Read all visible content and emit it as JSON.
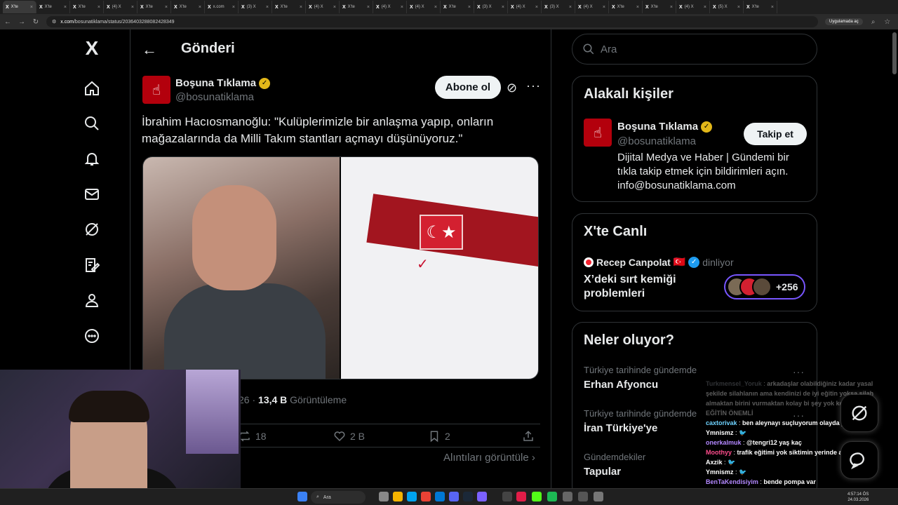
{
  "browser": {
    "active_tab": "X'te",
    "tabs": [
      "X'te",
      "X'te",
      "X'te",
      "(4) X",
      "X'te",
      "X'te",
      "x.com",
      "(3) X",
      "X'te",
      "(4) X",
      "X'te",
      "(4) X",
      "(4) X",
      "X'te",
      "(3) X",
      "(4) X",
      "(3) X",
      "(4) X",
      "X'te",
      "X'te",
      "(4) X",
      "(5) X",
      "X'te"
    ],
    "url_host": "x.com",
    "url_path": "/bosunatiklama/status/2036403288082428349",
    "app_button": "Uygulamada aç"
  },
  "nav": {
    "logo": "X",
    "items": [
      "home-icon",
      "search-icon",
      "notifications-icon",
      "messages-icon",
      "grok-icon",
      "lists-icon",
      "profile-icon",
      "more-icon"
    ]
  },
  "post": {
    "header_title": "Gönderi",
    "author_name": "Boşuna Tıklama",
    "author_handle": "@bosunatiklama",
    "subscribe_label": "Abone ol",
    "text": "İbrahim Hacıosmanoğlu: \"Kulüplerimizle bir anlaşma yapıp, onların mağazalarında da Milli Takım stantları açmayı düşünüyoruz.\"",
    "time_partial": "26",
    "views": "13,4 B",
    "views_label": "Görüntüleme",
    "retweets": "18",
    "likes": "2 B",
    "bookmarks": "2",
    "quotes_link": "Alıntıları görüntüle"
  },
  "sidebar": {
    "search_placeholder": "Ara",
    "related": {
      "title": "Alakalı kişiler",
      "name": "Boşuna Tıklama",
      "handle": "@bosunatiklama",
      "follow_label": "Takip et",
      "bio": "Dijital Medya ve Haber | Gündemi bir tıkla takip etmek için bildirimleri açın. info@bosunatiklama.com"
    },
    "live": {
      "title": "X'te Canlı",
      "host": "Recep Canpolat",
      "host_flag": "🇹🇷",
      "status": "dinliyor",
      "topic": "X’deki sırt kemiği problemleri",
      "listener_count": "+256"
    },
    "trends": {
      "title": "Neler oluyor?",
      "items": [
        {
          "context": "Türkiye tarihinde gündemde",
          "name": "Erhan Afyoncu"
        },
        {
          "context": "Türkiye tarihinde gündemde",
          "name": "İran Türkiye'ye"
        },
        {
          "context": "Gündemdekiler",
          "name": "Tapular"
        }
      ]
    }
  },
  "chat": [
    {
      "user": "Turkmensel_Yoruk",
      "msg": "arkadaşlar olabildiğiniz kadar yasal şekilde silahlanın ama kendinizi de iyi eğitin yoksa silah almaktan birini vurmaktan kolay bi şey yok kendinizi iyi EĞİTİN ÖNEMLİ",
      "color": "#8a8f98",
      "faded": true
    },
    {
      "user": "caxtorivak",
      "msg": "ben aleynayı suçluyorum olayda ya hala",
      "color": "#6fd3ff"
    },
    {
      "user": "Ymnismz",
      "msg": "🐦",
      "color": "#ffffff"
    },
    {
      "user": "onerkalmuk",
      "msg": "@tengri12 yaş kaç",
      "color": "#b388ff"
    },
    {
      "user": "Moothyy",
      "msg": "trafik eğitimi yok siktimin yerinde amk",
      "color": "#ff4d8d"
    },
    {
      "user": "Axzik",
      "msg": "🐦",
      "color": "#ffffff"
    },
    {
      "user": "Ymnismz",
      "msg": "🐦",
      "color": "#ffffff"
    },
    {
      "user": "BenTaKendisiyim",
      "msg": "bende pompa var",
      "color": "#b388ff"
    }
  ],
  "taskbar": {
    "search": "Ara",
    "time": "4:57:14 ÖS",
    "date": "24.03.2026"
  },
  "colors": {
    "accent": "#1d9bf0",
    "brand_red": "#b3000c",
    "gold_badge": "#e2b719",
    "live_border": "#7856ff"
  }
}
